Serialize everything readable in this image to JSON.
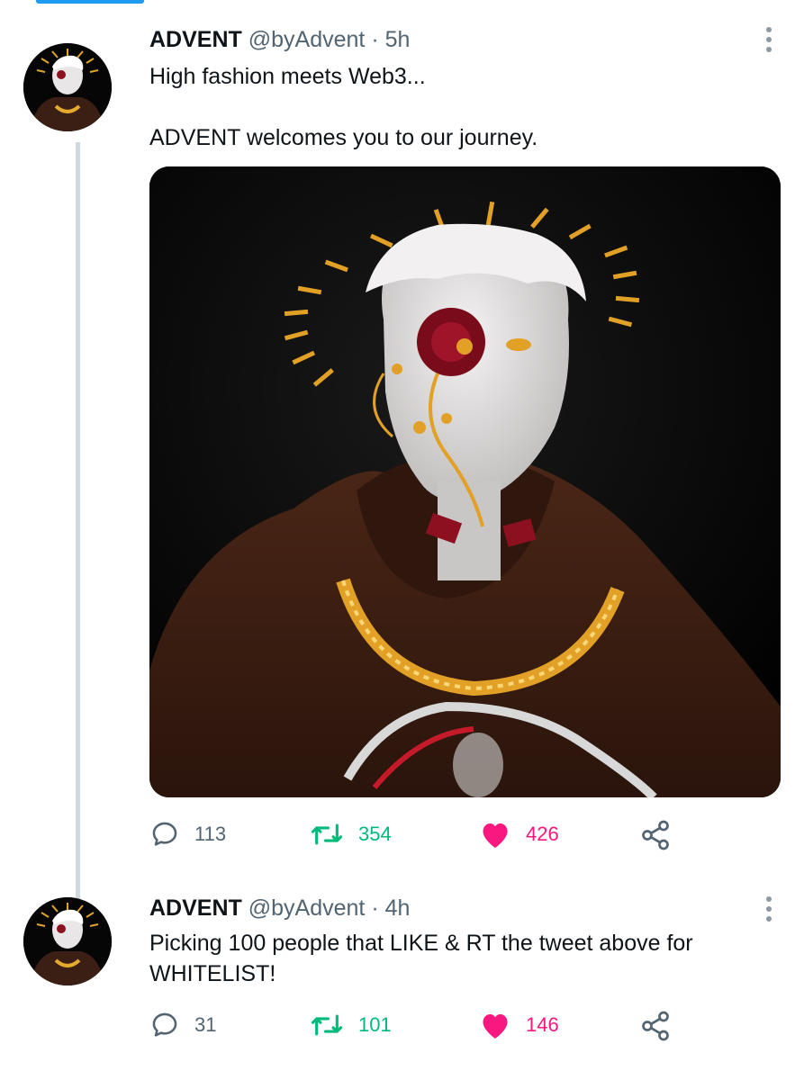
{
  "tweets": [
    {
      "name": "ADVENT",
      "handle": "@byAdvent",
      "separator": "·",
      "time": "5h",
      "text": "High fashion meets Web3...\n\nADVENT welcomes you to our journey.",
      "replies": "113",
      "retweets": "354",
      "likes": "426",
      "has_media": true
    },
    {
      "name": "ADVENT",
      "handle": "@byAdvent",
      "separator": "·",
      "time": "4h",
      "text": "Picking 100 people that LIKE & RT the tweet above for WHITELIST!",
      "replies": "31",
      "retweets": "101",
      "likes": "146",
      "has_media": false
    }
  ],
  "icons": {
    "reply": "speech-bubble",
    "retweet": "retweet-arrows",
    "like": "heart-filled",
    "share": "share-nodes",
    "more": "vertical-ellipsis"
  },
  "colors": {
    "accent": "#1d9bf0",
    "retweet": "#00ba7c",
    "like": "#f91880",
    "muted": "#536471"
  }
}
